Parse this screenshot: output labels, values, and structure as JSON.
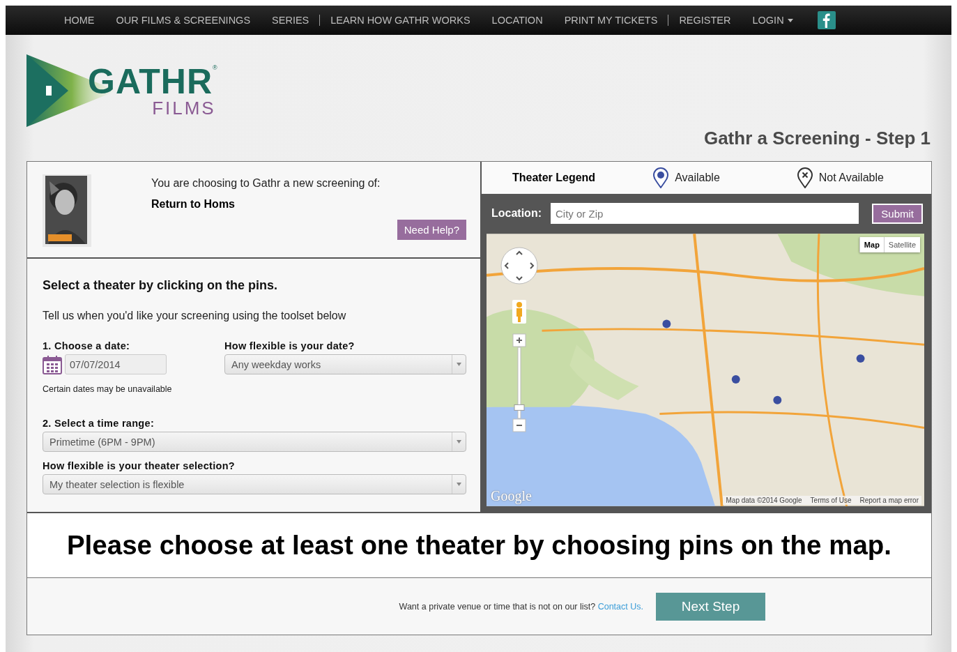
{
  "nav": {
    "items": [
      {
        "label": "HOME",
        "divider": false,
        "has_menu": false
      },
      {
        "label": "OUR FILMS & SCREENINGS",
        "divider": false,
        "has_menu": false
      },
      {
        "label": "SERIES",
        "divider": false,
        "has_menu": false
      },
      {
        "label": "LEARN HOW GATHR WORKS",
        "divider": true,
        "has_menu": false
      },
      {
        "label": "LOCATION",
        "divider": false,
        "has_menu": false
      },
      {
        "label": "PRINT MY TICKETS",
        "divider": false,
        "has_menu": false
      },
      {
        "label": "REGISTER",
        "divider": true,
        "has_menu": false
      },
      {
        "label": "LOGIN",
        "divider": false,
        "has_menu": true
      }
    ]
  },
  "logo": {
    "name": "GATHR",
    "mark": "®",
    "tagline": "FILMS"
  },
  "step_title": "Gathr a Screening - Step 1",
  "film": {
    "intro": "You are choosing to Gathr a new screening of:",
    "title": "Return to Homs",
    "help_button": "Need Help?"
  },
  "selection": {
    "heading": "Select a theater by clicking on the pins.",
    "hint": "Tell us when you'd like your screening using the toolset below"
  },
  "date": {
    "label": "1. Choose a date:",
    "value": "07/07/2014",
    "note": "Certain dates may be unavailable"
  },
  "date_flex": {
    "label": "How flexible is your date?",
    "value": "Any weekday works"
  },
  "time_range": {
    "label": "2. Select a time range:",
    "value": "Primetime (6PM - 9PM)"
  },
  "theater_flex": {
    "label": "How flexible is your theater selection?",
    "value": "My theater selection is flexible"
  },
  "legend": {
    "title": "Theater Legend",
    "items": [
      {
        "kind": "available",
        "label": "Available"
      },
      {
        "kind": "unavailable",
        "label": "Not Available"
      }
    ]
  },
  "location": {
    "label": "Location:",
    "placeholder": "City or Zip",
    "button": "Submit"
  },
  "map": {
    "zoom": {
      "level": 0.1
    },
    "types": [
      {
        "label": "Map",
        "selected": true
      },
      {
        "label": "Satellite",
        "selected": false
      }
    ],
    "logo": "Google",
    "attribution": [
      "Map data ©2014 Google",
      "Terms of Use",
      "Report a map error"
    ]
  },
  "message": "Please choose at least one theater by choosing pins on the map.",
  "footer": {
    "text": "Want a private venue or time that is not on our list?",
    "link": "Contact Us.",
    "button": "Next Step"
  }
}
